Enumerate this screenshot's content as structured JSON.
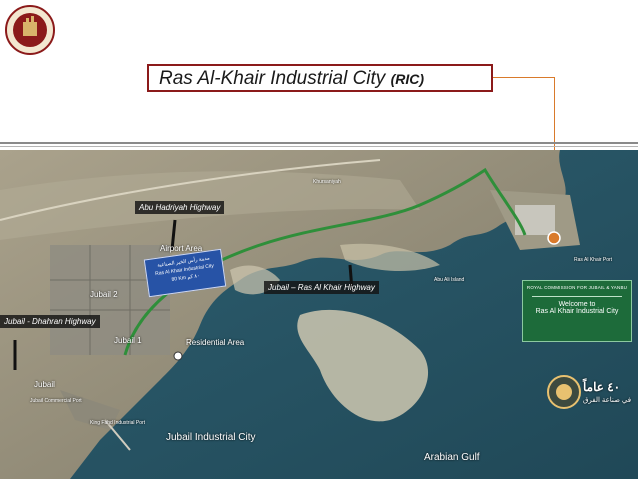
{
  "header": {
    "title_main": "Ras Al-Khair Industrial City",
    "title_abbr": "(RIC)"
  },
  "map": {
    "labels": {
      "abu_hadriyah": "Abu Hadriyah Highway",
      "airport_area": "Airport Area",
      "khursaniyah": "Khursaniyah",
      "jubail_rak_highway": "Jubail – Ras Al Khair Highway",
      "jubail_2": "Jubail 2",
      "jubail_dhahran": "Jubail - Dhahran Highway",
      "jubail_1": "Jubail 1",
      "residential_area": "Residential Area",
      "jubail": "Jubail",
      "jubail_commercial_port": "Jubail Commercial Port",
      "king_fahd_port": "King Fahd Industrial Port",
      "jubail_industrial_city": "Jubail Industrial City",
      "arabian_gulf": "Arabian Gulf",
      "ras_al_khair_port": "Ras Al Khair Port",
      "abu_ali_island": "Abu Ali Island"
    },
    "sign": {
      "arabic": "مدينة رأس الخير الصناعية",
      "english": "Ras Al Khair Industrial City",
      "distance": "80 Km",
      "distance_ar": "٨٠ كم"
    },
    "welcome_panel": {
      "header": "ROYAL COMMISSION FOR JUBAIL & YANBU",
      "line1": "Welcome to",
      "line2": "Ras Al Khair Industrial City"
    },
    "badge": {
      "number": "٤٠ عاماً",
      "subtitle": "في صناعة الفرق"
    }
  },
  "colors": {
    "title_border": "#8b1a1a",
    "connector": "#d97a2b",
    "highway": "#2f8f3a",
    "sea": "#2d5a6b",
    "land": "#9c9480",
    "panel": "#1d6b3a"
  }
}
